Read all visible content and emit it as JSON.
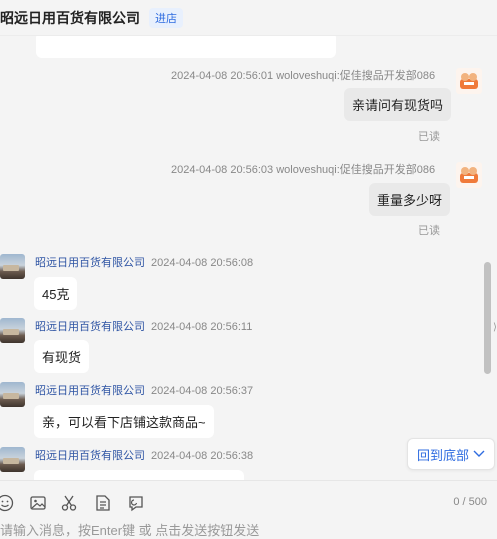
{
  "header": {
    "shop_name": "昭远日用百货有限公司",
    "enter_label": "进店"
  },
  "messages": [
    {
      "meta": "2024-04-08 20:56:01  woloveshuqi:促佳搜品开发部086",
      "text": "亲请问有现货吗",
      "status": "已读"
    },
    {
      "meta": "2024-04-08 20:56:03  woloveshuqi:促佳搜品开发部086",
      "text": "重量多少呀",
      "status": "已读"
    },
    {
      "sender": "昭远日用百货有限公司",
      "time": "2024-04-08 20:56:08",
      "text": "45克"
    },
    {
      "sender": "昭远日用百货有限公司",
      "time": "2024-04-08 20:56:11",
      "text": "有现货"
    },
    {
      "sender": "昭远日用百货有限公司",
      "time": "2024-04-08 20:56:37",
      "text": "亲，可以看下店铺这款商品~"
    },
    {
      "sender": "昭远日用百货有限公司",
      "time": "2024-04-08 20:56:38",
      "text": ""
    }
  ],
  "back_to_bottom": "回到底部",
  "counter": "0 / 500",
  "input_placeholder": "请输入消息，按Enter键 或 点击发送按钮发送",
  "toolbar_icons": [
    "emoji-icon",
    "image-icon",
    "scissors-icon",
    "document-icon",
    "history-icon"
  ],
  "colors": {
    "accent": "#2f6ce0",
    "sender": "#2f55a4"
  }
}
